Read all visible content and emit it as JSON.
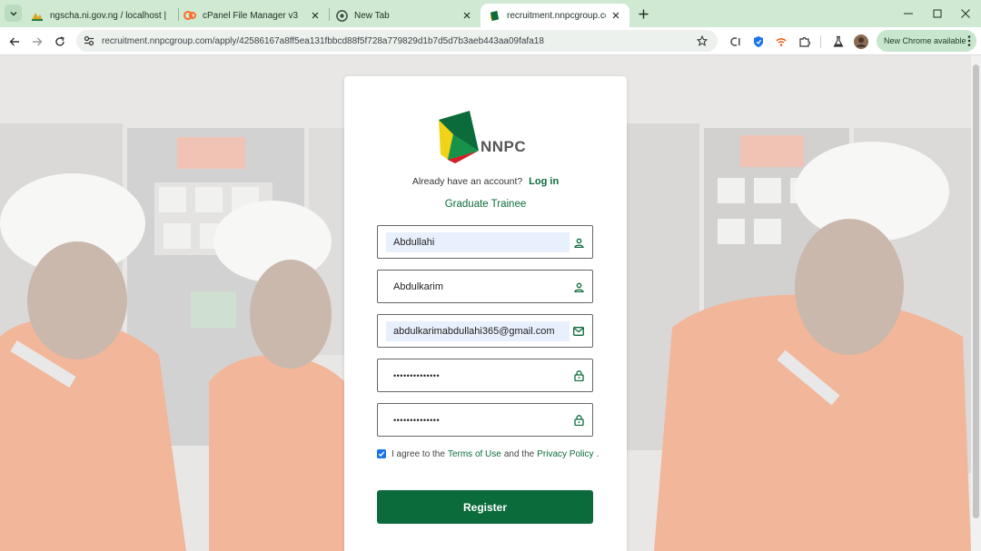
{
  "browser": {
    "tabs": [
      {
        "title": "ngscha.ni.gov.ng / localhost | p",
        "active": false
      },
      {
        "title": "cPanel File Manager v3",
        "active": false
      },
      {
        "title": "New Tab",
        "active": false
      },
      {
        "title": "recruitment.nnpcgroup.com/ap",
        "active": true
      }
    ],
    "url": "recruitment.nnpcgroup.com/apply/42586167a8ff5ea131fbbcd88f5f728a779829d1b7d5d7b3aeb443aa09fafa18",
    "update_chip": "New Chrome available",
    "colors": {
      "tabstrip": "#cfe9d3",
      "chip": "#c7e6cd"
    }
  },
  "brand": {
    "name": "NNPC",
    "colors": {
      "primary": "#0b6b3a",
      "yellow": "#f3d317",
      "red": "#d32026"
    }
  },
  "auth": {
    "prompt": "Already have an account?",
    "login_label": "Log in",
    "role": "Graduate Trainee"
  },
  "form": {
    "first_name": {
      "value": "Abdullahi",
      "icon": "user-icon"
    },
    "last_name": {
      "value": "Abdulkarim",
      "icon": "user-icon"
    },
    "email": {
      "value": "abdulkarimabdullahi365@gmail.com",
      "icon": "mail-icon"
    },
    "password": {
      "value": "••••••••••••••",
      "icon": "lock-icon"
    },
    "confirm_password": {
      "value": "••••••••••••••",
      "icon": "lock-icon"
    },
    "agree": {
      "checked": true,
      "prefix": "I agree to the",
      "terms": "Terms of Use",
      "middle": "and the",
      "privacy": "Privacy Policy",
      "suffix": "."
    },
    "submit_label": "Register"
  }
}
